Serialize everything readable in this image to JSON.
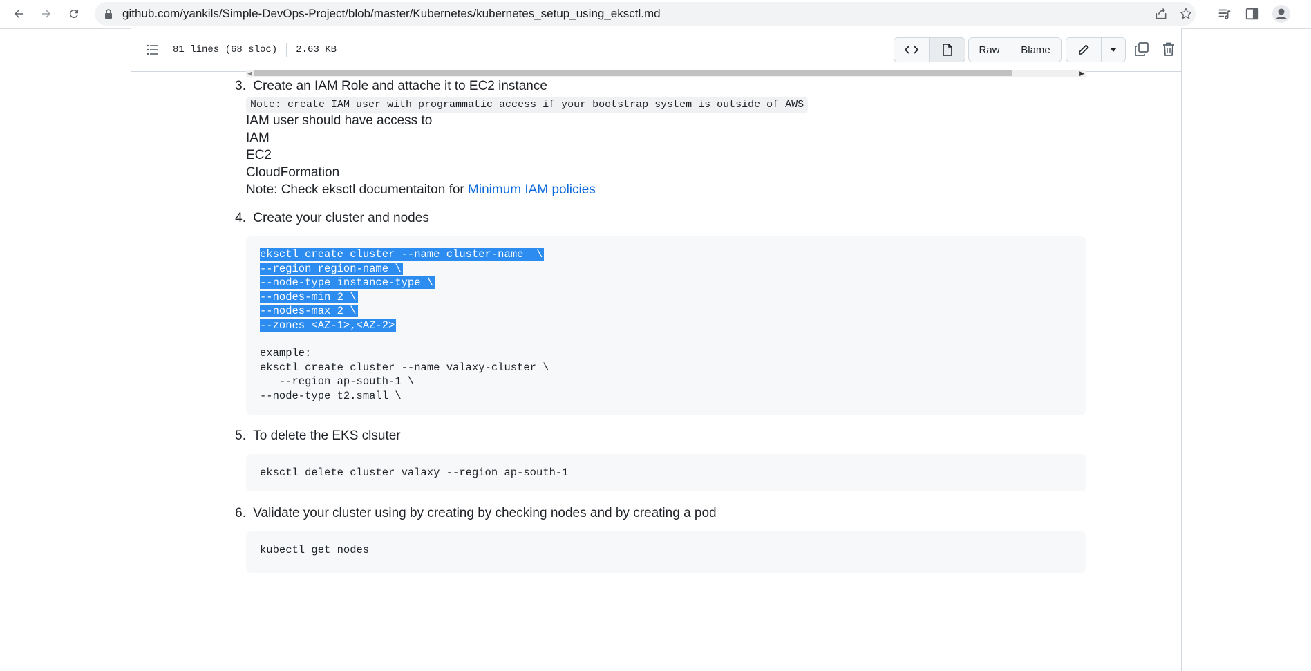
{
  "browser": {
    "url": "github.com/yankils/Simple-DevOps-Project/blob/master/Kubernetes/kubernetes_setup_using_eksctl.md",
    "back_icon": "arrow-left-icon",
    "forward_icon": "arrow-right-icon",
    "reload_icon": "reload-icon"
  },
  "file_header": {
    "lines": "81 lines (68 sloc)",
    "size": "2.63 KB",
    "raw_label": "Raw",
    "blame_label": "Blame"
  },
  "content": {
    "step3": {
      "number": "3.",
      "title": "Create an IAM Role and attache it to EC2 instance",
      "note_code": "Note: create IAM user with programmatic access if your bootstrap system is outside of AWS",
      "line1": "IAM user should have access to",
      "line2": "IAM",
      "line3": "EC2",
      "line4": "CloudFormation",
      "note_prefix": "Note: Check eksctl documentaiton for ",
      "note_link": "Minimum IAM policies"
    },
    "step4": {
      "number": "4.",
      "title": "Create your cluster and nodes",
      "code_selected": [
        "eksctl create cluster --name cluster-name  \\",
        "--region region-name \\",
        "--node-type instance-type \\",
        "--nodes-min 2 \\",
        "--nodes-max 2 \\",
        "--zones <AZ-1>,<AZ-2>"
      ],
      "code_rest": [
        "example:",
        "eksctl create cluster --name valaxy-cluster \\",
        "   --region ap-south-1 \\",
        "--node-type t2.small \\"
      ]
    },
    "step5": {
      "number": "5.",
      "title": "To delete the EKS clsuter",
      "code": "eksctl delete cluster valaxy --region ap-south-1"
    },
    "step6": {
      "number": "6.",
      "title": "Validate your cluster using by creating by checking nodes and by creating a pod",
      "code": "kubectl get nodes"
    }
  },
  "colors": {
    "link": "#0969da",
    "selection": "#2d8cf0",
    "code_bg": "#f6f8fa"
  }
}
